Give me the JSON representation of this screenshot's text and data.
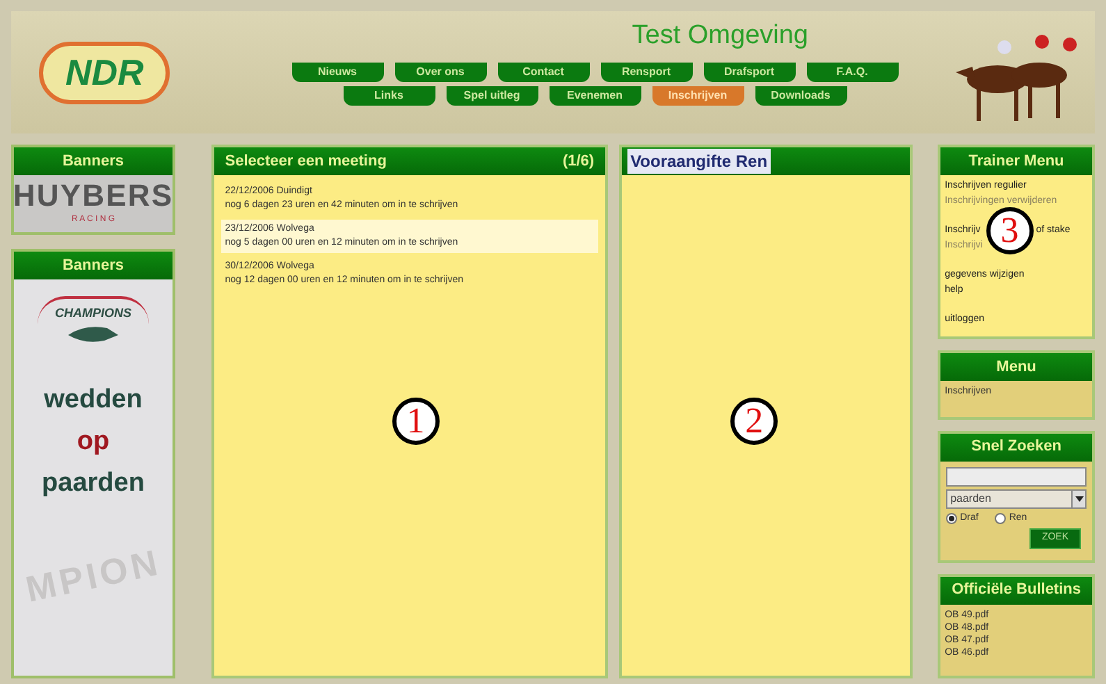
{
  "header": {
    "logo": "NDR",
    "title": "Test Omgeving",
    "nav_rows": [
      [
        {
          "label": "Nieuws",
          "selected": false
        },
        {
          "label": "Over ons",
          "selected": false
        },
        {
          "label": "Contact",
          "selected": false
        },
        {
          "label": "Rensport",
          "selected": false
        },
        {
          "label": "Drafsport",
          "selected": false
        },
        {
          "label": "F.A.Q.",
          "selected": false
        }
      ],
      [
        {
          "label": "Links",
          "selected": false
        },
        {
          "label": "Spel uitleg",
          "selected": false
        },
        {
          "label": "Evenemen",
          "selected": false
        },
        {
          "label": "Inschrijven",
          "selected": true
        },
        {
          "label": "Downloads",
          "selected": false
        }
      ]
    ]
  },
  "left": {
    "banners": [
      {
        "title": "Banners",
        "kind": "huybers",
        "logo": "HUYBERS",
        "sub": "R A C I N G"
      },
      {
        "title": "Banners",
        "kind": "champions",
        "logo": "CHAMPIONS",
        "lines": [
          "wedden",
          "op",
          "paarden"
        ],
        "faded": "MPION"
      }
    ]
  },
  "meetings": {
    "title": "Selecteer een meeting",
    "count": "(1/6)",
    "callout": "1",
    "items": [
      {
        "date": "22/12/2006 Duindigt",
        "info": "nog 6 dagen 23 uren en 42 minuten om in te schrijven",
        "selected": false
      },
      {
        "date": "23/12/2006 Wolvega",
        "info": "nog 5 dagen 00 uren en 12 minuten om in te schrijven",
        "selected": true
      },
      {
        "date": "30/12/2006 Wolvega",
        "info": "nog 12 dagen 00 uren en 12 minuten om in te schrijven",
        "selected": false
      }
    ]
  },
  "race": {
    "title": "Vooraangifte Ren",
    "callout": "2"
  },
  "trainer_menu": {
    "title": "Trainer Menu",
    "callout": "3",
    "groups": [
      [
        {
          "parts": [
            "Inschrijven regulier"
          ],
          "disabled": false
        },
        {
          "parts": [
            "Inschrijvingen verwijderen"
          ],
          "disabled": true
        }
      ],
      [
        {
          "parts": [
            "Inschrijv",
            "of stake"
          ],
          "disabled": false
        },
        {
          "parts": [
            "Inschrijvi"
          ],
          "disabled": true
        }
      ],
      [
        {
          "parts": [
            "gegevens wijzigen"
          ],
          "disabled": false
        },
        {
          "parts": [
            "help"
          ],
          "disabled": false
        }
      ],
      [
        {
          "parts": [
            "uitloggen"
          ],
          "disabled": false
        }
      ]
    ]
  },
  "menu": {
    "title": "Menu",
    "items": [
      "Inschrijven"
    ]
  },
  "quick_search": {
    "title": "Snel Zoeken",
    "select": "paarden",
    "radios": [
      {
        "label": "Draf",
        "selected": true
      },
      {
        "label": "Ren",
        "selected": false
      }
    ],
    "button": "ZOEK"
  },
  "bulletins": {
    "title": "Officiële Bulletins",
    "items": [
      "OB 49.pdf",
      "OB 48.pdf",
      "OB 47.pdf",
      "OB 46.pdf"
    ]
  }
}
